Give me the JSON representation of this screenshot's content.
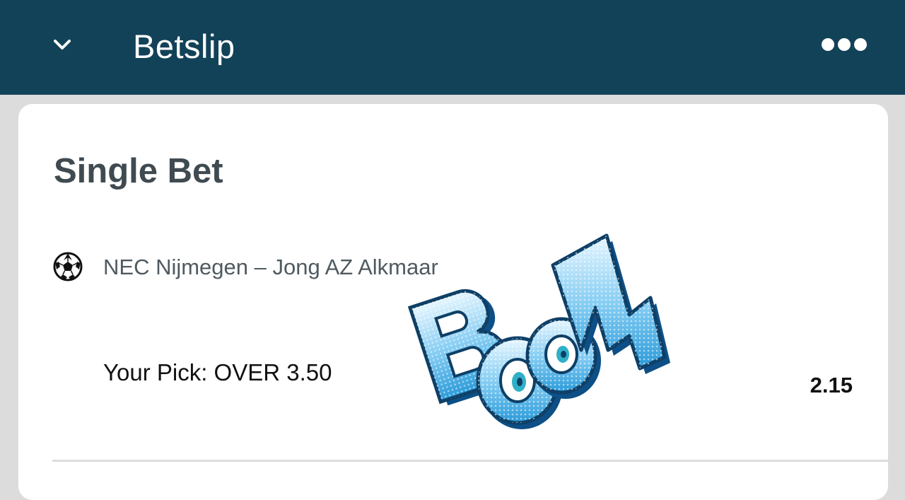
{
  "header": {
    "title": "Betslip",
    "background_color": "#124258",
    "collapse_icon": "chevron-down-icon",
    "more_icon": "more-options-icon"
  },
  "betslip": {
    "heading": "Single Bet",
    "selection": {
      "sport_icon": "soccer-ball-icon",
      "event_name": "NEC Nijmegen – Jong AZ Alkmaar",
      "pick": "Your Pick: OVER 3.50",
      "odds": "2.15"
    }
  },
  "sticker": {
    "text": "BOOM",
    "color": "#2a9ad8"
  }
}
